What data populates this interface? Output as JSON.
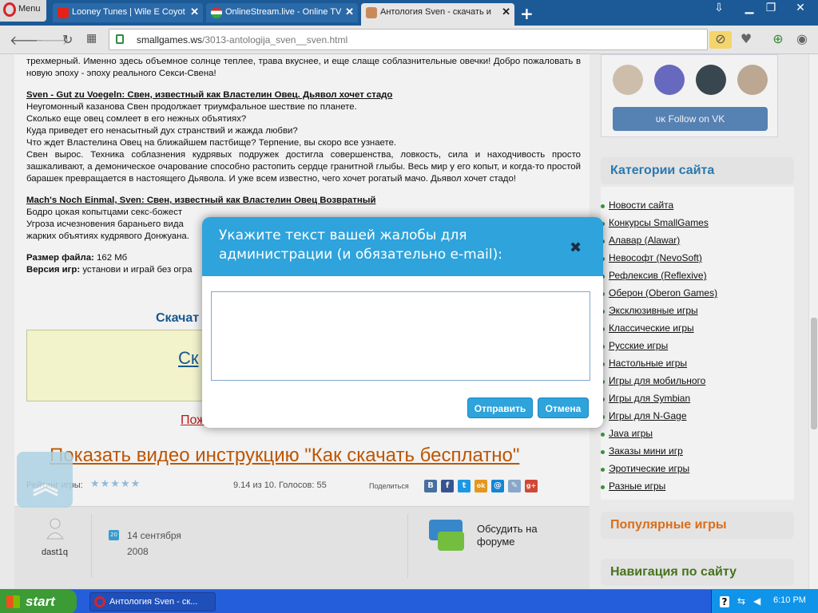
{
  "browser": {
    "menu_label": "Menu",
    "tabs": [
      {
        "label": "Looney Tunes | Wile E Coyot",
        "close": "✕"
      },
      {
        "label": "OnlineStream.live - Online TV",
        "close": "✕"
      },
      {
        "label": "Антология Sven - скачать и",
        "close": "✕"
      }
    ],
    "new_tab": "+",
    "url_domain": "smallgames.ws",
    "url_path": "/3013-antologija_sven__sven.html"
  },
  "article": {
    "intro": "трехмерный. Именно здесь объемное солнце теплее, трава вкуснее, и еще слаще соблазнительные овечки! Добро пожаловать в новую эпоху - эпоху реального Секси-Свена!",
    "h1": "Sven - Gut zu Voegeln: Свен, известный как Властелин Овец. Дьявол хочет стадо",
    "p1_l1": "Неугомонный казанова Свен продолжает триумфальное шествие по планете.",
    "p1_l2": "Сколько еще овец сомлеет в его нежных объятиях?",
    "p1_l3": "Куда приведет его ненасытный дух странствий и жажда любви?",
    "p1_l4": "Что ждет Властелина Овец на ближайшем пастбище? Терпение, вы скоро все узнаете.",
    "p1_l5": "Свен вырос. Техника соблазнения кудрявых подружек достигла совершенства, ловкость, сила и находчивость просто зашкаливают, а демоническое очарование способно растопить сердце гранитной глыбы. Весь мир у его копыт, и когда-то простой барашек превращается в настоящего Дьявола. И уже всем известно, чего хочет рогатый мачо. Дьявол хочет стадо!",
    "h2": "Mach's Noch Einmal, Sven: Свен, известный как Властелин Овец Возвратный",
    "p2_l1": "Бодро цокая копытцами секс-божест",
    "p2_l2": "Угроза исчезновения бараньего вида",
    "p2_l3": "жарких объятиях кудрявого Донжуана.",
    "size_label": "Размер файла:",
    "size_value": " 162 Мб",
    "version_label": "Версия игр:",
    "version_value": " установи и играй без огра",
    "download_title": "Скачат",
    "download_link": "Ск",
    "red_link": "Пож",
    "video_link": "Показать видео инструкцию \"Как скачать бесплатно\"",
    "rating_label": "Рейтинг игры:",
    "stars": "★★★★★",
    "score": "9.14 из 10. Голосов: 55",
    "share_label": "Поделиться",
    "share_icons": [
      "В",
      "f",
      "t",
      "ok",
      "@",
      "✎",
      "g+"
    ],
    "author": "dast1q",
    "calendar_day": "20",
    "date_line1": "14 сентября",
    "date_line2": "2008",
    "forum_text": "Обсудить на форуме",
    "up_arrow": "︽"
  },
  "sidebar": {
    "vk_button": "Follow on VK",
    "categories_title": "Категории сайта",
    "categories": [
      "Новости сайта",
      "Конкурсы SmallGames",
      "Алавар (Alawar)",
      "Невософт (NevoSoft)",
      "Рефлексив (Reflexive)",
      "Оберон (Oberon Games)",
      "Эксклюзивные игры",
      "Классические игры",
      "Русские игры",
      "Настольные игры",
      "Игры для мобильного",
      "Игры для Symbian",
      "Игры для N-Gage",
      "Java игры",
      "Заказы мини игр",
      "Эротические игры",
      "Разные игры"
    ],
    "popular_title": "Популярные игры",
    "nav_title": "Навигация по сайту"
  },
  "dialog": {
    "title": "Укажите текст вашей жалобы для администрации (и обязательно e-mail):",
    "close": "✖",
    "textarea_value": "",
    "send_button": "Отправить",
    "cancel_button": "Отмена"
  },
  "taskbar": {
    "start_label": "start",
    "task_label": "Антология Sven - ск...",
    "clock": "6:10 PM"
  },
  "colors": {
    "dialog_header": "#2ea3dc",
    "categories_title": "#2e7fb8",
    "popular_title": "#e8731a",
    "nav_title": "#4a7a1e",
    "tabbar": "#1c5a97"
  }
}
